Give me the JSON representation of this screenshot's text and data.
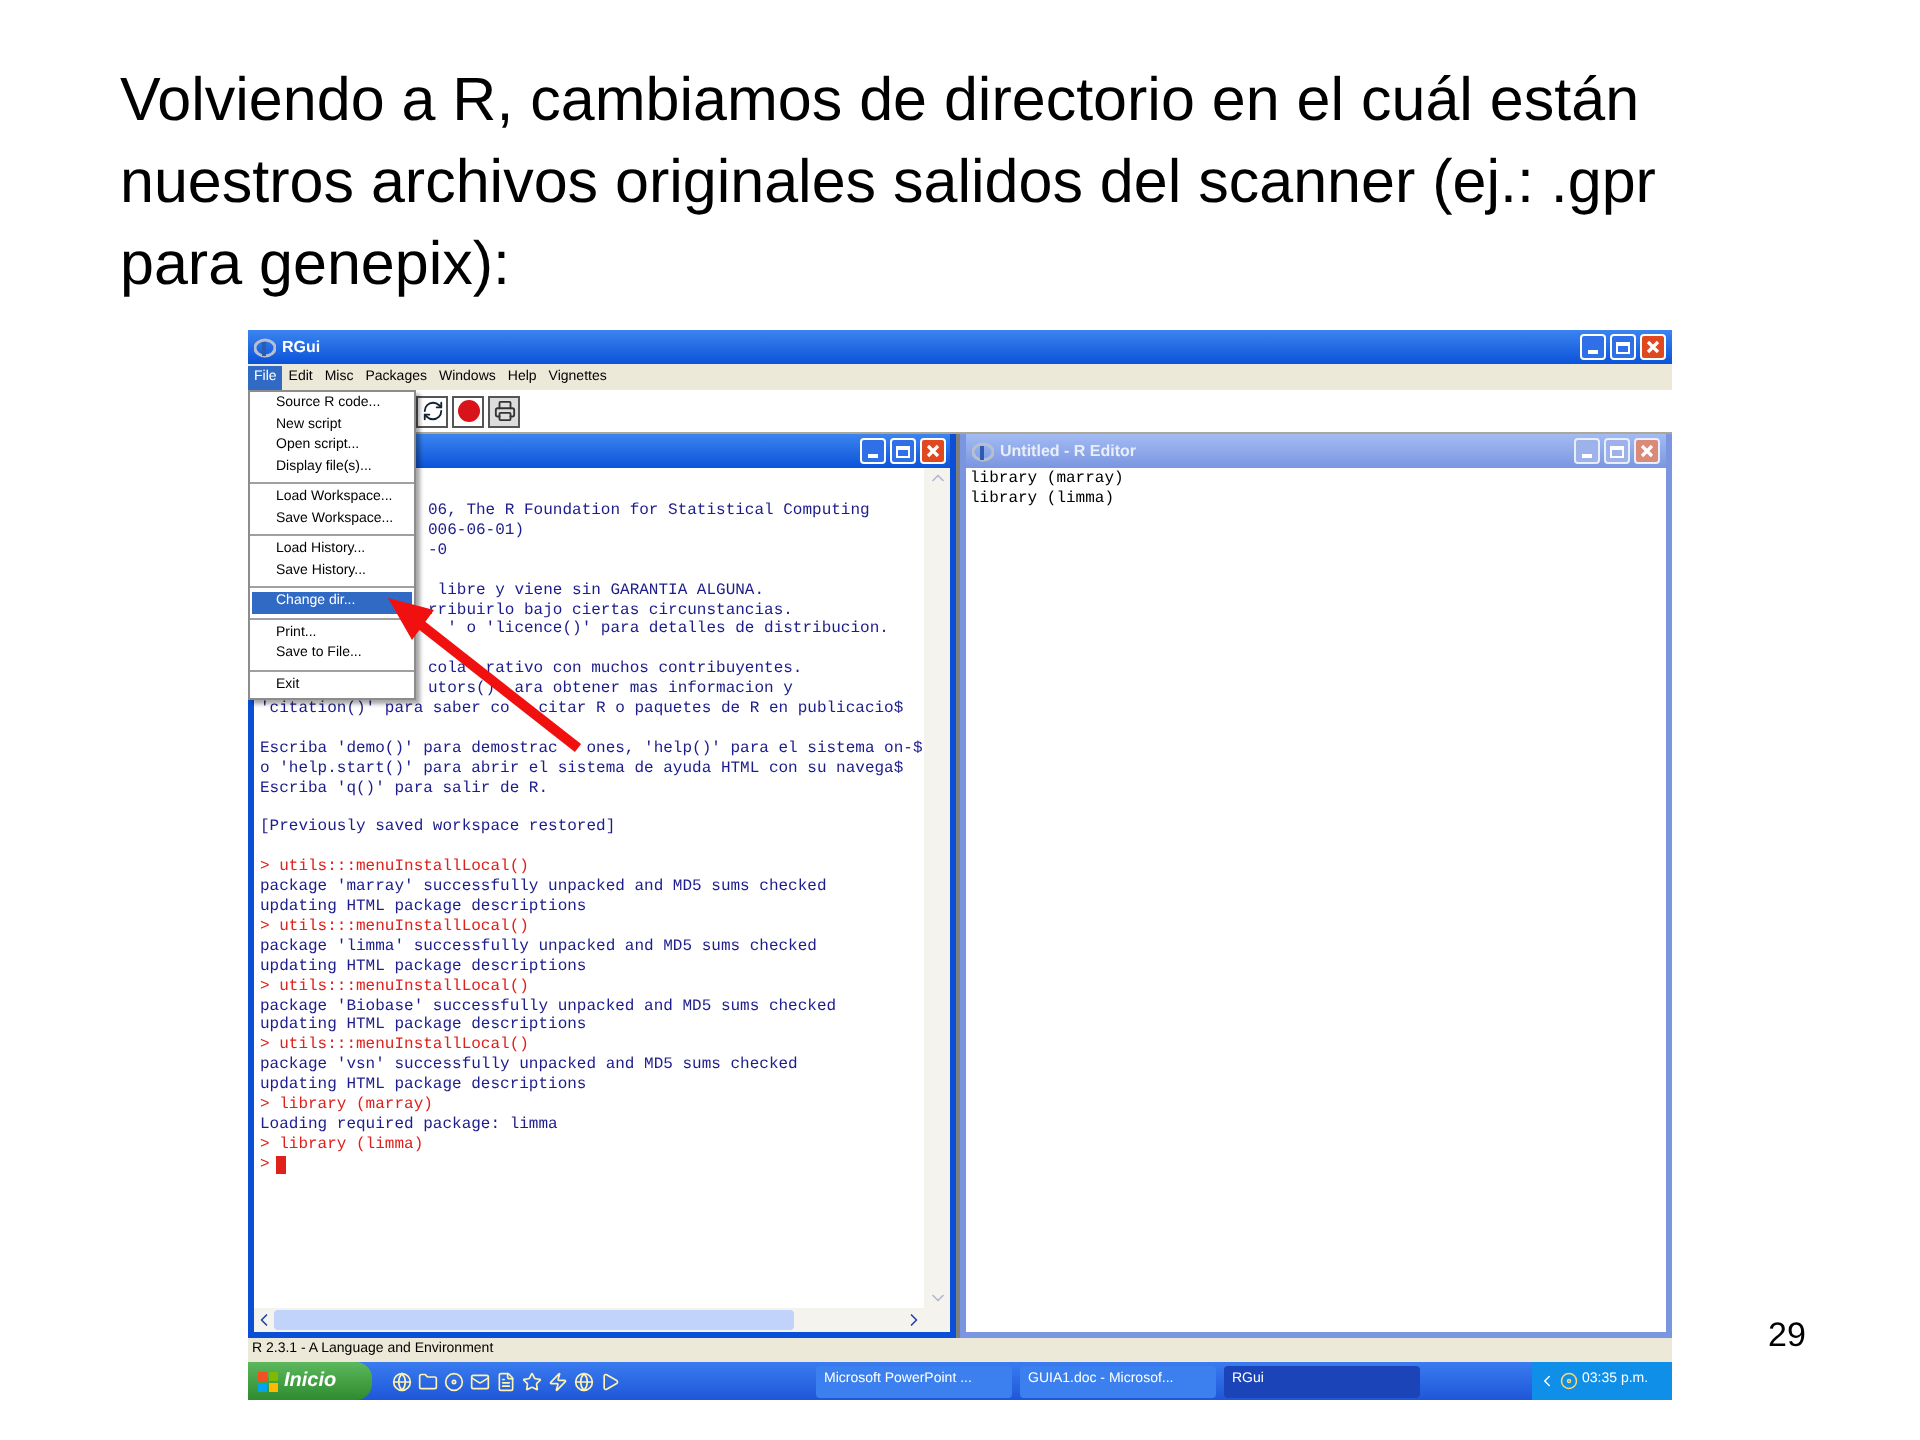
{
  "slide": {
    "title": "Volviendo a R, cambiamos de directorio en el cuál están nuestros archivos originales salidos del scanner (ej.: .gpr para genepix):",
    "page_number": "29"
  },
  "window": {
    "title": "RGui"
  },
  "menubar": [
    {
      "label": "File",
      "selected": true
    },
    {
      "label": "Edit",
      "selected": false
    },
    {
      "label": "Misc",
      "selected": false
    },
    {
      "label": "Packages",
      "selected": false
    },
    {
      "label": "Windows",
      "selected": false
    },
    {
      "label": "Help",
      "selected": false
    },
    {
      "label": "Vignettes",
      "selected": false
    }
  ],
  "file_menu": [
    [
      {
        "label": "Source R code...",
        "selected": false
      },
      {
        "label": "New script",
        "selected": false
      },
      {
        "label": "Open script...",
        "selected": false
      },
      {
        "label": "Display file(s)...",
        "selected": false
      }
    ],
    [
      {
        "label": "Load Workspace...",
        "selected": false
      },
      {
        "label": "Save Workspace...",
        "selected": false
      }
    ],
    [
      {
        "label": "Load History...",
        "selected": false
      },
      {
        "label": "Save History...",
        "selected": false
      }
    ],
    [
      {
        "label": "Change dir...",
        "selected": true
      }
    ],
    [
      {
        "label": "Print...",
        "selected": false
      },
      {
        "label": "Save to File...",
        "selected": false
      }
    ],
    [
      {
        "label": "Exit",
        "selected": false
      }
    ]
  ],
  "console": {
    "lines": [
      {
        "kind": "partial",
        "text": "06, The R Foundation for Statistical Computing"
      },
      {
        "kind": "partial",
        "text": "006-06-01)"
      },
      {
        "kind": "partial",
        "text": "-0"
      },
      {
        "kind": "blank"
      },
      {
        "kind": "partial",
        "text": " libre y viene sin GARANTIA ALGUNA."
      },
      {
        "kind": "partial",
        "text": "rribuirlo bajo ciertas circunstancias."
      },
      {
        "kind": "partial",
        "text": "  ' o 'licence()' para detalles de distribucion."
      },
      {
        "kind": "blank"
      },
      {
        "kind": "partial",
        "text": "cola  rativo con muchos contribuyentes."
      },
      {
        "kind": "partial",
        "text": "utors()  ara obtener mas informacion y"
      },
      {
        "kind": "output",
        "text": "'citation()' para saber co   citar R o paquetes de R en publicacio$"
      },
      {
        "kind": "blank"
      },
      {
        "kind": "output",
        "text": "Escriba 'demo()' para demostrac   ones, 'help()' para el sistema on-$"
      },
      {
        "kind": "output",
        "text": "o 'help.start()' para abrir el sistema de ayuda HTML con su navega$"
      },
      {
        "kind": "output",
        "text": "Escriba 'q()' para salir de R."
      },
      {
        "kind": "blank"
      },
      {
        "kind": "output",
        "text": "[Previously saved workspace restored]"
      },
      {
        "kind": "blank"
      },
      {
        "kind": "command",
        "text": "> utils:::menuInstallLocal()"
      },
      {
        "kind": "output",
        "text": "package 'marray' successfully unpacked and MD5 sums checked"
      },
      {
        "kind": "output",
        "text": "updating HTML package descriptions"
      },
      {
        "kind": "command",
        "text": "> utils:::menuInstallLocal()"
      },
      {
        "kind": "output",
        "text": "package 'limma' successfully unpacked and MD5 sums checked"
      },
      {
        "kind": "output",
        "text": "updating HTML package descriptions"
      },
      {
        "kind": "command",
        "text": "> utils:::menuInstallLocal()"
      },
      {
        "kind": "output",
        "text": "package 'Biobase' successfully unpacked and MD5 sums checked"
      },
      {
        "kind": "output",
        "text": "updating HTML package descriptions"
      },
      {
        "kind": "command",
        "text": "> utils:::menuInstallLocal()"
      },
      {
        "kind": "output",
        "text": "package 'vsn' successfully unpacked and MD5 sums checked"
      },
      {
        "kind": "output",
        "text": "updating HTML package descriptions"
      },
      {
        "kind": "command",
        "text": "> library (marray)"
      },
      {
        "kind": "output",
        "text": "Loading required package: limma"
      },
      {
        "kind": "command",
        "text": "> library (limma)"
      },
      {
        "kind": "cursor",
        "text": ">"
      }
    ]
  },
  "editor": {
    "title": "Untitled - R Editor",
    "lines": [
      "library (marray)",
      "library (limma)"
    ]
  },
  "status_bar": "R 2.3.1 - A Language and Environment",
  "taskbar": {
    "start": "Inicio",
    "tasks": [
      {
        "label": "Microsoft PowerPoint ...",
        "selected": false
      },
      {
        "label": "GUIA1.doc - Microsof...",
        "selected": false
      },
      {
        "label": "RGui",
        "selected": true
      }
    ],
    "clock": "03:35 p.m."
  }
}
